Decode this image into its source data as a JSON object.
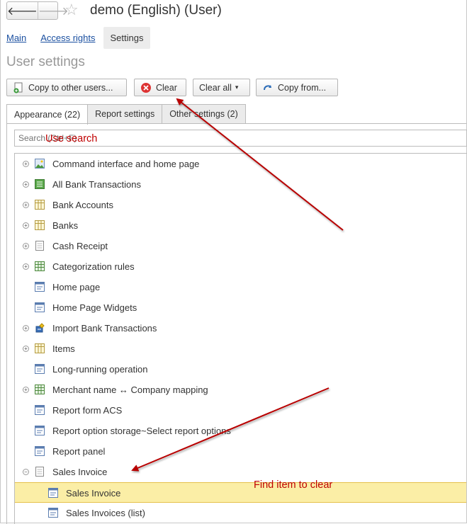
{
  "window": {
    "title": "demo (English) (User)"
  },
  "nav": {
    "back": "🡐",
    "forward": "🡒"
  },
  "subnav": {
    "main": "Main",
    "access_rights": "Access rights",
    "settings": "Settings"
  },
  "page": {
    "title": "User settings"
  },
  "toolbar": {
    "copy_to_other": "Copy to other users...",
    "clear": "Clear",
    "clear_all": "Clear all",
    "clear_all_caret": "▾",
    "copy_from": "Copy from..."
  },
  "tabs": [
    {
      "label": "Appearance (22)"
    },
    {
      "label": "Report settings"
    },
    {
      "label": "Other settings (2)"
    }
  ],
  "search": {
    "placeholder": "Search (Ctrl+F)"
  },
  "tree": [
    {
      "label": "Command interface and home page",
      "icon": "picture-icon",
      "expander": "plus"
    },
    {
      "label": "All Bank Transactions",
      "icon": "list-icon",
      "expander": "plus"
    },
    {
      "label": "Bank Accounts",
      "icon": "catalog-icon",
      "expander": "plus"
    },
    {
      "label": "Banks",
      "icon": "catalog-icon",
      "expander": "plus"
    },
    {
      "label": "Cash Receipt",
      "icon": "document-icon",
      "expander": "plus"
    },
    {
      "label": "Categorization rules",
      "icon": "register-icon",
      "expander": "plus"
    },
    {
      "label": "Home page",
      "icon": "form-icon",
      "expander": "none"
    },
    {
      "label": "Home Page Widgets",
      "icon": "form-icon",
      "expander": "none"
    },
    {
      "label": "Import Bank Transactions",
      "icon": "processing-icon",
      "expander": "plus"
    },
    {
      "label": "Items",
      "icon": "catalog-icon",
      "expander": "plus"
    },
    {
      "label": "Long-running operation",
      "icon": "form-icon",
      "expander": "none"
    },
    {
      "label": "Merchant name ↔ Company mapping",
      "icon": "register-icon",
      "expander": "plus"
    },
    {
      "label": "Report form ACS",
      "icon": "form-icon",
      "expander": "none"
    },
    {
      "label": "Report option storage~Select report options",
      "icon": "form-icon",
      "expander": "none"
    },
    {
      "label": "Report panel",
      "icon": "form-icon",
      "expander": "none"
    },
    {
      "label": "Sales Invoice",
      "icon": "document-icon",
      "expander": "minus"
    },
    {
      "label": "Sales Invoice",
      "icon": "form-icon",
      "expander": "child",
      "selected": true
    },
    {
      "label": "Sales Invoices (list)",
      "icon": "form-icon",
      "expander": "child"
    }
  ],
  "annotations": {
    "use_search": "Use search",
    "find_item": "Find item to clear"
  },
  "colors": {
    "annotation": "#c00000",
    "selection": "#fbeea6",
    "link": "#1a4fa0"
  }
}
